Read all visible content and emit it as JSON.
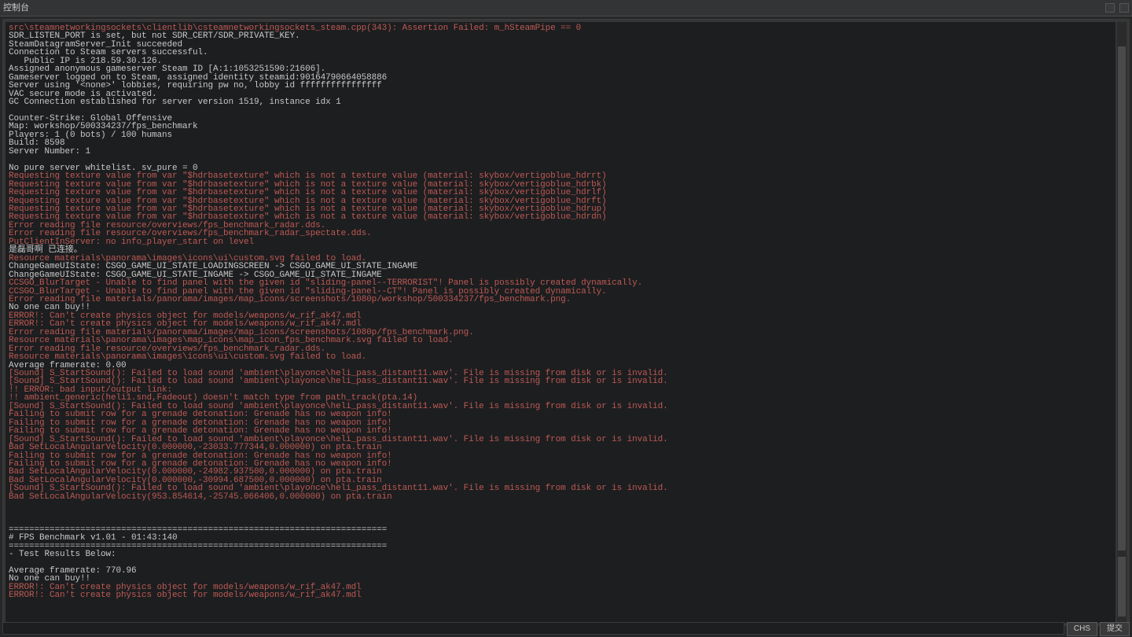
{
  "title": "控制台",
  "footer": {
    "ime_label": "CHS",
    "submit_label": "提交"
  },
  "scrollbar": {
    "thumb_top_pct": 4,
    "thumb_bot_pct": 88,
    "thumb2_top_pct": 89,
    "thumb2_bot_pct": 99
  },
  "lines": [
    {
      "t": "src\\steamnetworkingsockets\\clientlib\\csteamnetworkingsockets_steam.cpp(343): Assertion Failed: m_hSteamPipe == 0",
      "c": "e"
    },
    {
      "t": "SDR_LISTEN_PORT is set, but not SDR_CERT/SDR_PRIVATE_KEY."
    },
    {
      "t": "SteamDatagramServer_Init succeeded"
    },
    {
      "t": "Connection to Steam servers successful."
    },
    {
      "t": "   Public IP is 218.59.30.126."
    },
    {
      "t": "Assigned anonymous gameserver Steam ID [A:1:1053251590:21606]."
    },
    {
      "t": "Gameserver logged on to Steam, assigned identity steamid:90164790664058886"
    },
    {
      "t": "Server using '<none>' lobbies, requiring pw no, lobby id ffffffffffffffff"
    },
    {
      "t": "VAC secure mode is activated."
    },
    {
      "t": "GC Connection established for server version 1519, instance idx 1"
    },
    {
      "t": ""
    },
    {
      "t": "Counter-Strike: Global Offensive"
    },
    {
      "t": "Map: workshop/500334237/fps_benchmark"
    },
    {
      "t": "Players: 1 (0 bots) / 100 humans"
    },
    {
      "t": "Build: 8598"
    },
    {
      "t": "Server Number: 1"
    },
    {
      "t": ""
    },
    {
      "t": "No pure server whitelist. sv_pure = 0"
    },
    {
      "t": "Requesting texture value from var \"$hdrbasetexture\" which is not a texture value (material: skybox/vertigoblue_hdrrt)",
      "c": "e"
    },
    {
      "t": "Requesting texture value from var \"$hdrbasetexture\" which is not a texture value (material: skybox/vertigoblue_hdrbk)",
      "c": "e"
    },
    {
      "t": "Requesting texture value from var \"$hdrbasetexture\" which is not a texture value (material: skybox/vertigoblue_hdrlf)",
      "c": "e"
    },
    {
      "t": "Requesting texture value from var \"$hdrbasetexture\" which is not a texture value (material: skybox/vertigoblue_hdrft)",
      "c": "e"
    },
    {
      "t": "Requesting texture value from var \"$hdrbasetexture\" which is not a texture value (material: skybox/vertigoblue_hdrup)",
      "c": "e"
    },
    {
      "t": "Requesting texture value from var \"$hdrbasetexture\" which is not a texture value (material: skybox/vertigoblue_hdrdn)",
      "c": "e"
    },
    {
      "t": "Error reading file resource/overviews/fps_benchmark_radar.dds.",
      "c": "e"
    },
    {
      "t": "Error reading file resource/overviews/fps_benchmark_radar_spectate.dds.",
      "c": "e"
    },
    {
      "t": "PutClientInServer: no info_player_start on level",
      "c": "e"
    },
    {
      "t": "是磊哥啊 已连接。"
    },
    {
      "t": "Resource materials\\panorama\\images\\icons\\ui\\custom.svg failed to load.",
      "c": "e"
    },
    {
      "t": "ChangeGameUIState: CSGO_GAME_UI_STATE_LOADINGSCREEN -> CSGO_GAME_UI_STATE_INGAME"
    },
    {
      "t": "ChangeGameUIState: CSGO_GAME_UI_STATE_INGAME -> CSGO_GAME_UI_STATE_INGAME"
    },
    {
      "t": "CCSGO_BlurTarget - Unable to find panel with the given id \"sliding-panel--TERRORIST\"! Panel is possibly created dynamically.",
      "c": "e"
    },
    {
      "t": "CCSGO_BlurTarget - Unable to find panel with the given id \"sliding-panel--CT\"! Panel is possibly created dynamically.",
      "c": "e"
    },
    {
      "t": "Error reading file materials/panorama/images/map_icons/screenshots/1080p/workshop/500334237/fps_benchmark.png.",
      "c": "e"
    },
    {
      "t": "No one can buy!!"
    },
    {
      "t": "ERROR!: Can't create physics object for models/weapons/w_rif_ak47.mdl",
      "c": "e"
    },
    {
      "t": "ERROR!: Can't create physics object for models/weapons/w_rif_ak47.mdl",
      "c": "e"
    },
    {
      "t": "Error reading file materials/panorama/images/map_icons/screenshots/1080p/fps_benchmark.png.",
      "c": "e"
    },
    {
      "t": "Resource materials\\panorama\\images\\map_icons\\map_icon_fps_benchmark.svg failed to load.",
      "c": "e"
    },
    {
      "t": "Error reading file resource/overviews/fps_benchmark_radar.dds.",
      "c": "e"
    },
    {
      "t": "Resource materials\\panorama\\images\\icons\\ui\\custom.svg failed to load.",
      "c": "e"
    },
    {
      "t": "Average framerate: 0.00"
    },
    {
      "t": "[Sound] S_StartSound(): Failed to load sound 'ambient\\playonce\\heli_pass_distant11.wav'. File is missing from disk or is invalid.",
      "c": "e"
    },
    {
      "t": "[Sound] S_StartSound(): Failed to load sound 'ambient\\playonce\\heli_pass_distant11.wav'. File is missing from disk or is invalid.",
      "c": "e"
    },
    {
      "t": "!! ERROR: bad input/output link:",
      "c": "e"
    },
    {
      "t": "!! ambient_generic(heli1.snd,Fadeout) doesn't match type from path_track(pta.14)",
      "c": "e"
    },
    {
      "t": "[Sound] S_StartSound(): Failed to load sound 'ambient\\playonce\\heli_pass_distant11.wav'. File is missing from disk or is invalid.",
      "c": "e"
    },
    {
      "t": "Failing to submit row for a grenade detonation: Grenade has no weapon info!",
      "c": "e"
    },
    {
      "t": "Failing to submit row for a grenade detonation: Grenade has no weapon info!",
      "c": "e"
    },
    {
      "t": "Failing to submit row for a grenade detonation: Grenade has no weapon info!",
      "c": "e"
    },
    {
      "t": "[Sound] S_StartSound(): Failed to load sound 'ambient\\playonce\\heli_pass_distant11.wav'. File is missing from disk or is invalid.",
      "c": "e"
    },
    {
      "t": "Bad SetLocalAngularVelocity(0.000000,-23033.777344,0.000000) on pta.train",
      "c": "e"
    },
    {
      "t": "Failing to submit row for a grenade detonation: Grenade has no weapon info!",
      "c": "e"
    },
    {
      "t": "Failing to submit row for a grenade detonation: Grenade has no weapon info!",
      "c": "e"
    },
    {
      "t": "Bad SetLocalAngularVelocity(0.000000,-24982.937500,0.000000) on pta.train",
      "c": "e"
    },
    {
      "t": "Bad SetLocalAngularVelocity(0.000000,-30994.687500,0.000000) on pta.train",
      "c": "e"
    },
    {
      "t": "[Sound] S_StartSound(): Failed to load sound 'ambient\\playonce\\heli_pass_distant11.wav'. File is missing from disk or is invalid.",
      "c": "e"
    },
    {
      "t": "Bad SetLocalAngularVelocity(953.854614,-25745.066406,0.000000) on pta.train",
      "c": "e"
    },
    {
      "t": ""
    },
    {
      "t": ""
    },
    {
      "t": ""
    },
    {
      "t": "=========================================================================="
    },
    {
      "t": "# FPS Benchmark v1.01 - 01:43:140"
    },
    {
      "t": "=========================================================================="
    },
    {
      "t": "- Test Results Below:"
    },
    {
      "t": ""
    },
    {
      "t": "Average framerate: 770.96"
    },
    {
      "t": "No one can buy!!"
    },
    {
      "t": "ERROR!: Can't create physics object for models/weapons/w_rif_ak47.mdl",
      "c": "e"
    },
    {
      "t": "ERROR!: Can't create physics object for models/weapons/w_rif_ak47.mdl",
      "c": "e"
    }
  ]
}
